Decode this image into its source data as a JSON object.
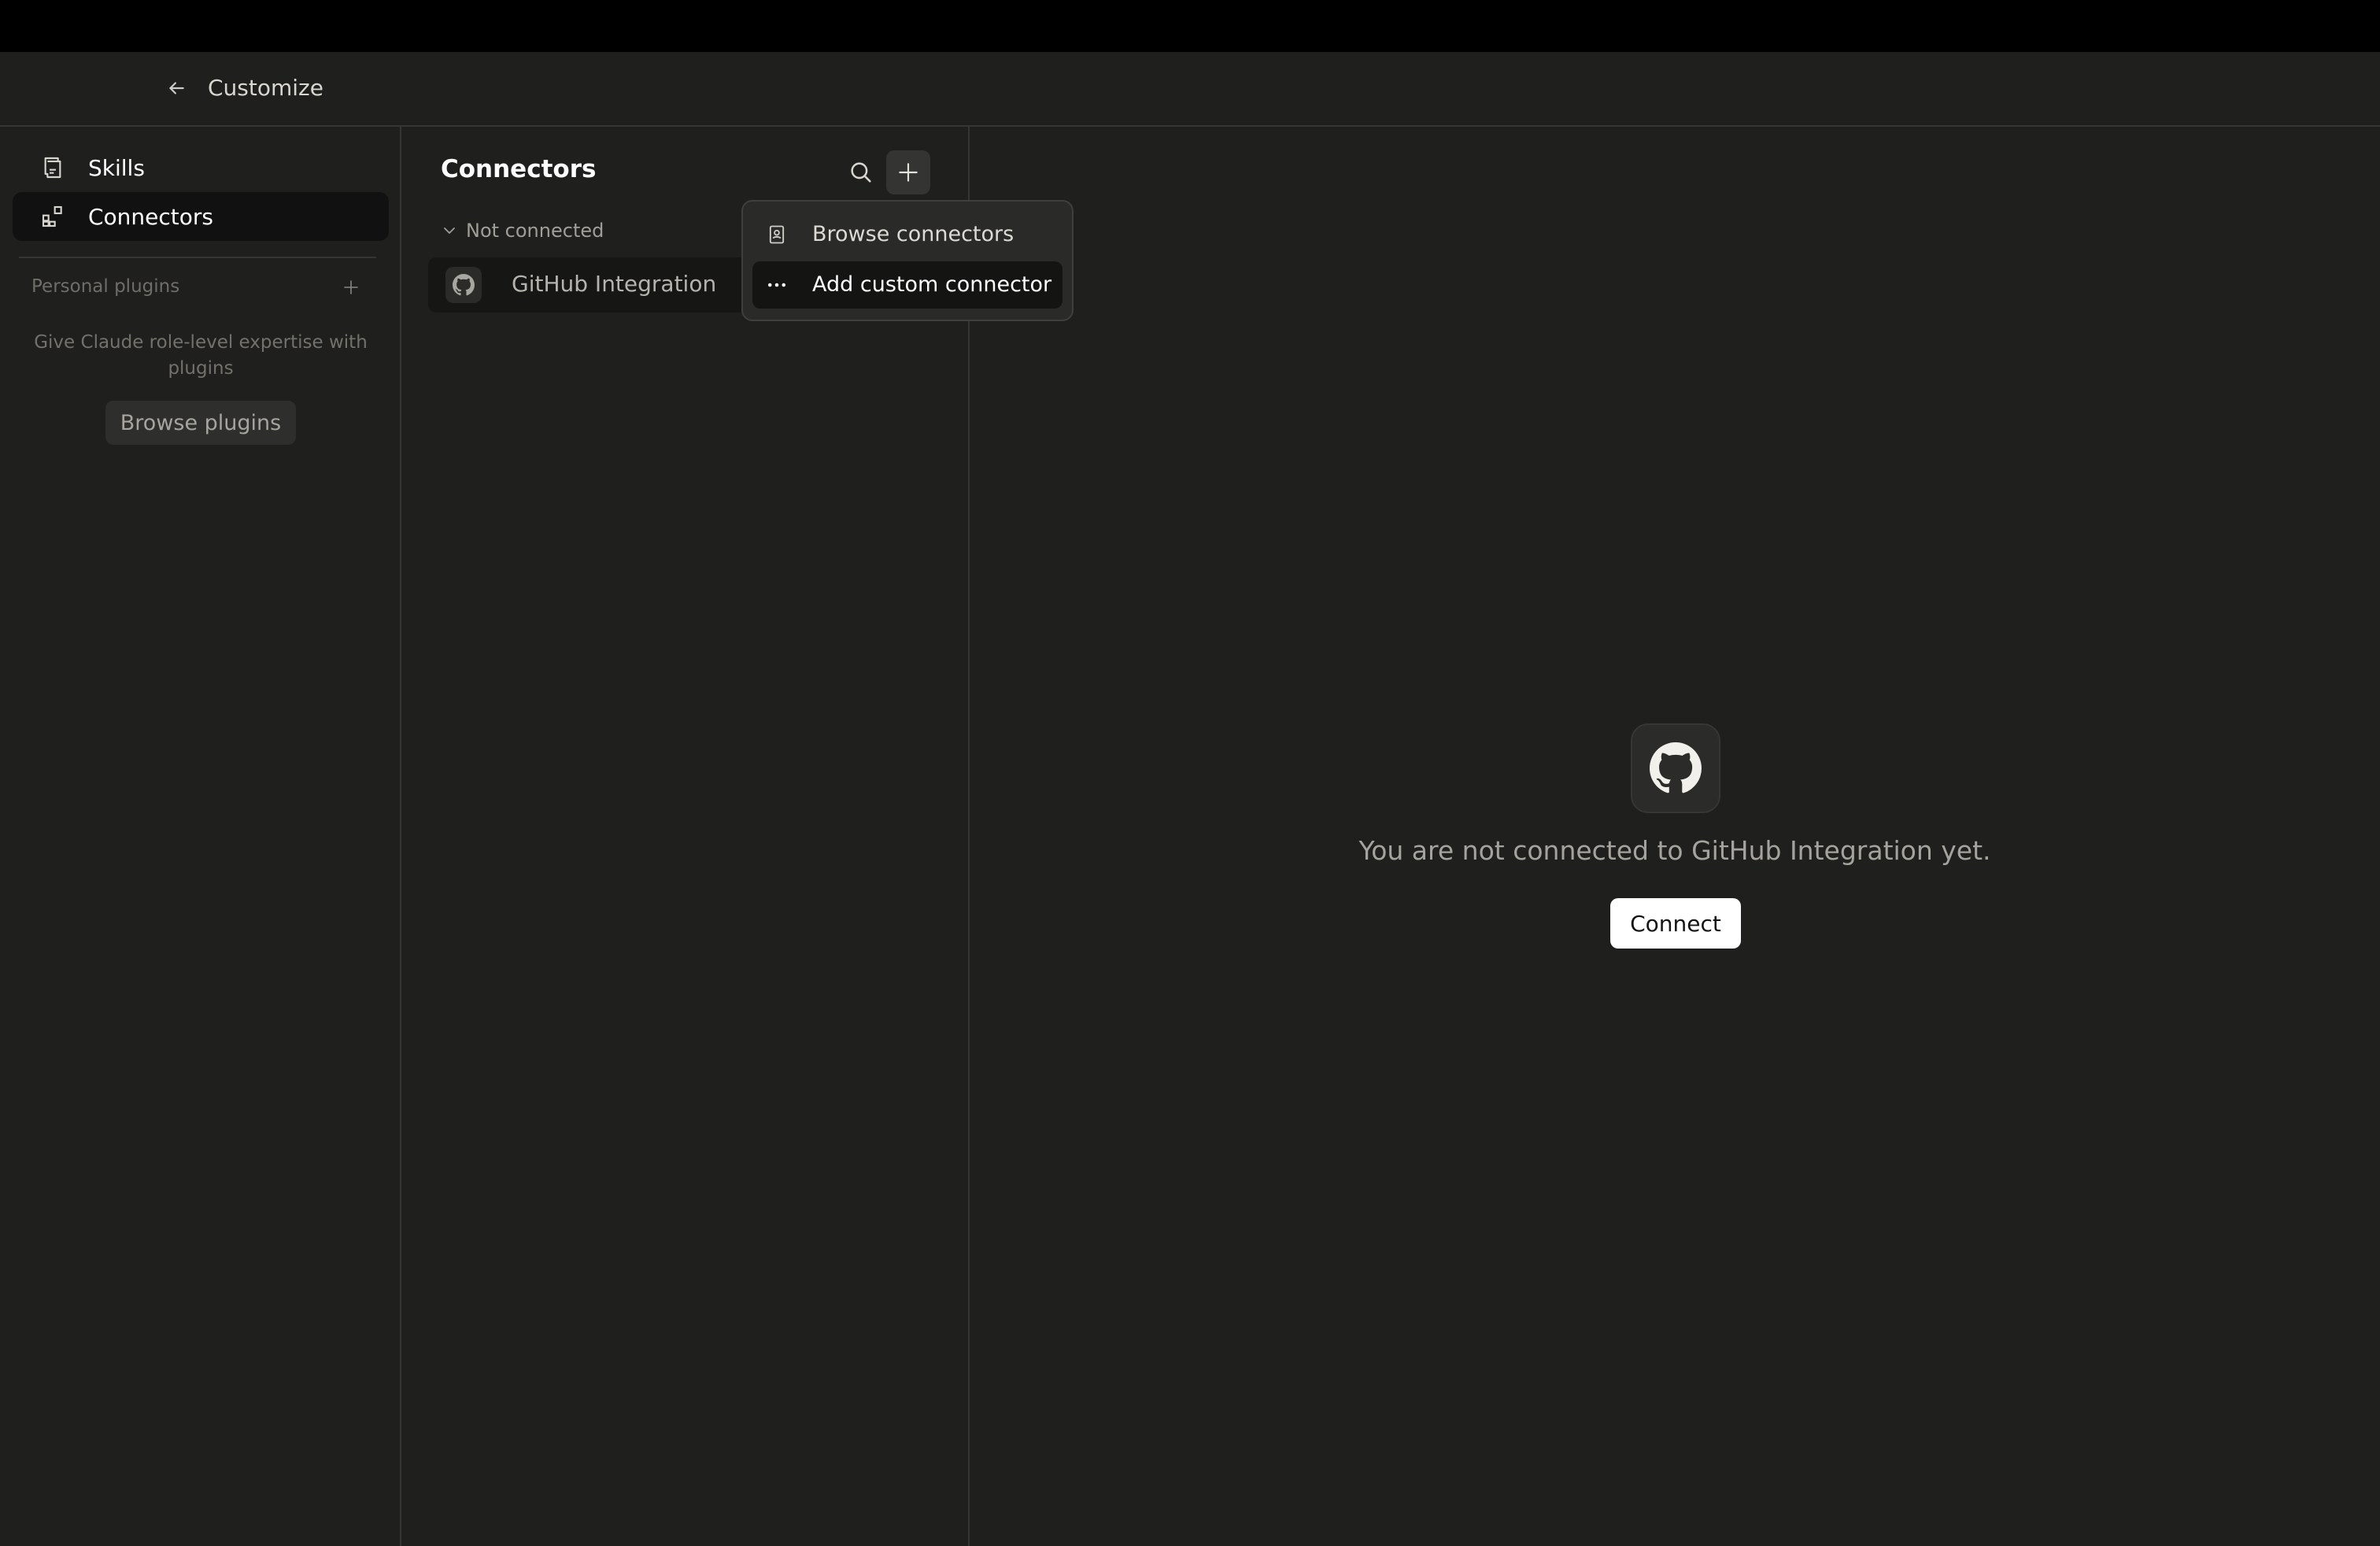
{
  "header": {
    "back_icon": "arrow-left-icon",
    "title": "Customize"
  },
  "sidebar": {
    "items": [
      {
        "label": "Skills",
        "icon": "skills-icon",
        "active": false
      },
      {
        "label": "Connectors",
        "icon": "connectors-icon",
        "active": true
      }
    ],
    "section_label": "Personal plugins",
    "hint": "Give Claude role-level expertise with plugins",
    "browse_plugins_label": "Browse plugins"
  },
  "middle": {
    "title": "Connectors",
    "group_label": "Not connected",
    "connectors": [
      {
        "label": "GitHub Integration",
        "icon": "github-icon"
      }
    ]
  },
  "dropdown": {
    "items": [
      {
        "label": "Browse connectors",
        "icon": "directory-icon",
        "highlighted": false
      },
      {
        "label": "Add custom connector",
        "icon": "ellipsis-icon",
        "highlighted": true
      }
    ]
  },
  "empty_state": {
    "message": "You are not connected to GitHub Integration yet.",
    "connect_label": "Connect"
  },
  "colors": {
    "background": "#1f1f1e",
    "topbar": "#000000",
    "active_item": "#111111",
    "primary_button": "#ffffff"
  }
}
